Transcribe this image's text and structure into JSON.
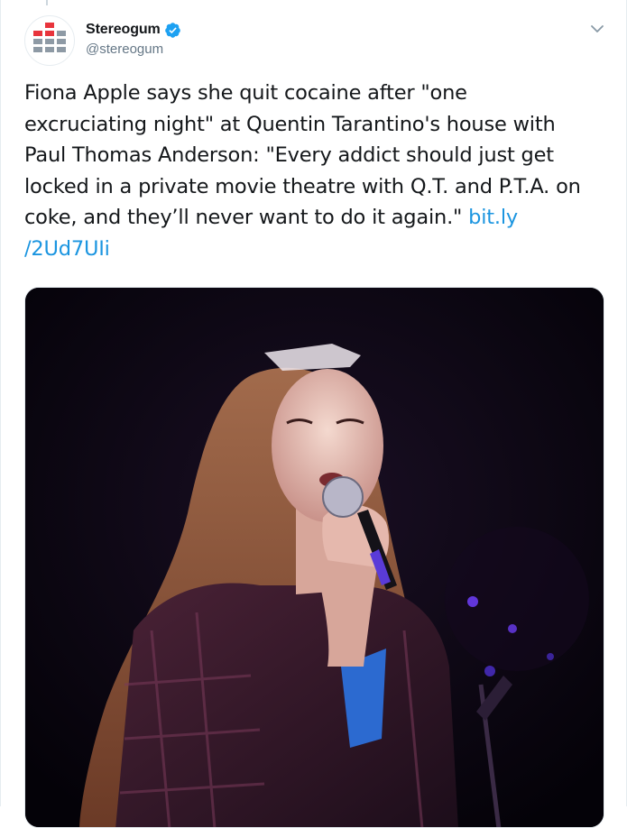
{
  "tweet": {
    "author": {
      "display_name": "Stereogum",
      "handle": "@stereogum",
      "verified": true,
      "avatar_icon": "stereogum-logo-icon"
    },
    "text_lines": [
      "Fiona Apple says she quit cocaine after \"one",
      "excruciating night\" at Quentin Tarantino's house with",
      "Paul Thomas Anderson: \"Every addict should just get",
      "locked in a private movie theatre with Q.T. and P.T.A. on",
      "coke, and they’ll never want to do it again.\" "
    ],
    "link_part1": "bit.ly",
    "link_part2": "/2Ud7UIi",
    "menu_icon": "chevron-down-icon",
    "media_icon": "photo"
  },
  "colors": {
    "text": "#14171a",
    "secondary": "#657786",
    "link": "#1b95e0",
    "verified": "#1da1f2",
    "logo_red": "#e8343c",
    "logo_gray": "#8e9aa5"
  }
}
